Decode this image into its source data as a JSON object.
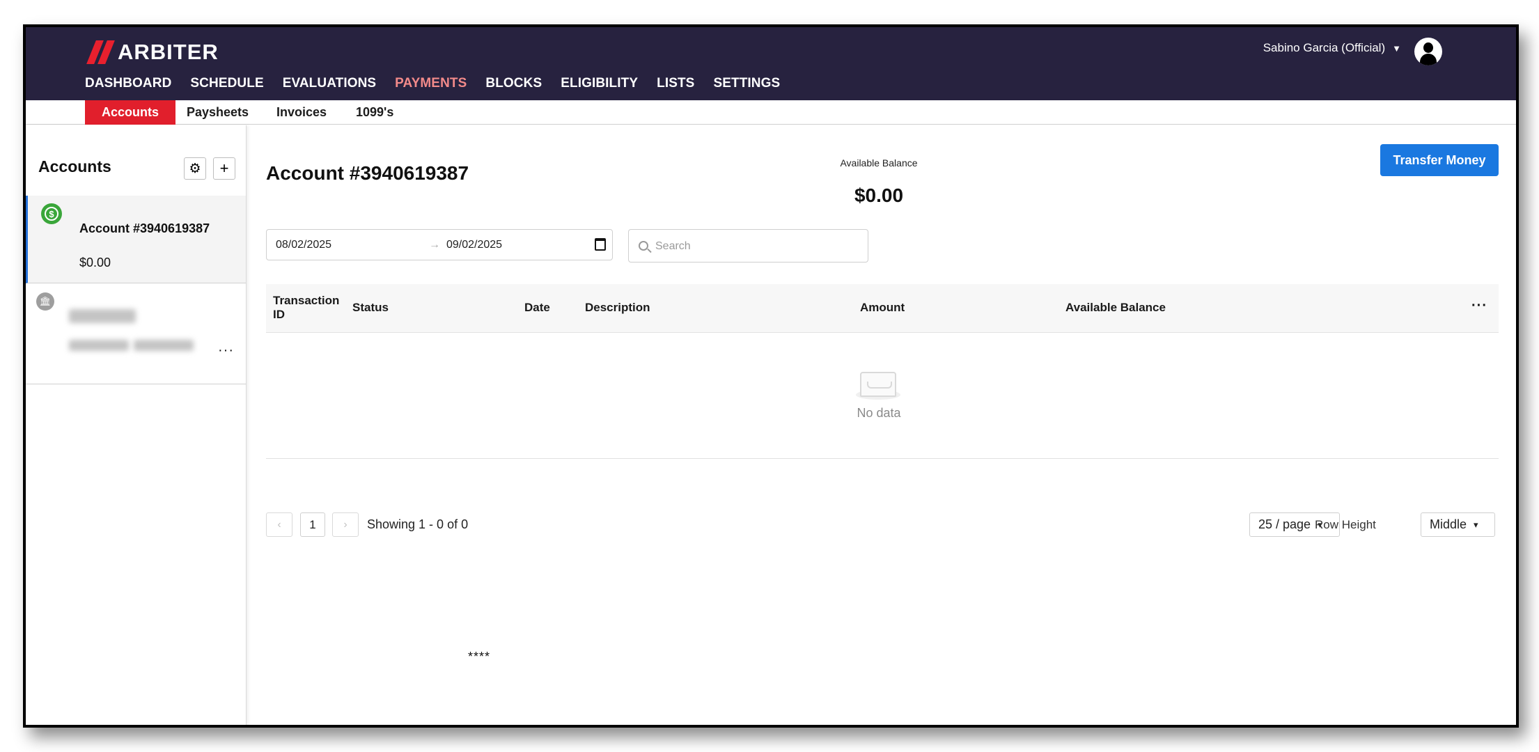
{
  "app": {
    "brand": "ARBITER",
    "user_label": "Sabino Garcia (Official)"
  },
  "mainnav": [
    {
      "label": "DASHBOARD"
    },
    {
      "label": "SCHEDULE"
    },
    {
      "label": "EVALUATIONS"
    },
    {
      "label": "PAYMENTS",
      "active": true
    },
    {
      "label": "BLOCKS"
    },
    {
      "label": "ELIGIBILITY"
    },
    {
      "label": "LISTS"
    },
    {
      "label": "SETTINGS"
    }
  ],
  "subnav": [
    {
      "label": "Accounts",
      "active": true
    },
    {
      "label": "Paysheets"
    },
    {
      "label": "Invoices"
    },
    {
      "label": "1099's"
    }
  ],
  "sidebar": {
    "title": "Accounts",
    "settings_icon": "gear-icon",
    "add_icon": "plus-icon",
    "accounts": [
      {
        "name": "Account #3940619387",
        "balance": "$0.00",
        "icon": "dollar-circle-icon",
        "selected": true
      },
      {
        "name": "",
        "balance": "",
        "icon": "bank-icon",
        "obscured": true
      }
    ]
  },
  "account": {
    "title": "Account #3940619387",
    "available_label": "Available Balance",
    "available_value": "$0.00",
    "transfer_label": "Transfer Money"
  },
  "filters": {
    "start_date": "08/02/2025",
    "end_date": "09/02/2025",
    "search_placeholder": "Search"
  },
  "table": {
    "columns": [
      "Transaction ID",
      "Status",
      "Date",
      "Description",
      "Amount",
      "Available Balance"
    ],
    "rows": [],
    "empty_text": "No data"
  },
  "pagination": {
    "current_page": "1",
    "showing": "Showing 1 - 0 of 0",
    "page_size": "25 / page",
    "row_height_label": "Row Height",
    "row_height_value": "Middle"
  },
  "footer_mark": "****",
  "colors": {
    "nav_bg": "#27223f",
    "brand_red": "#e11f2c",
    "active_nav": "#f28a8a",
    "primary_button": "#1a78e0",
    "balance_icon": "#3aa63a"
  }
}
